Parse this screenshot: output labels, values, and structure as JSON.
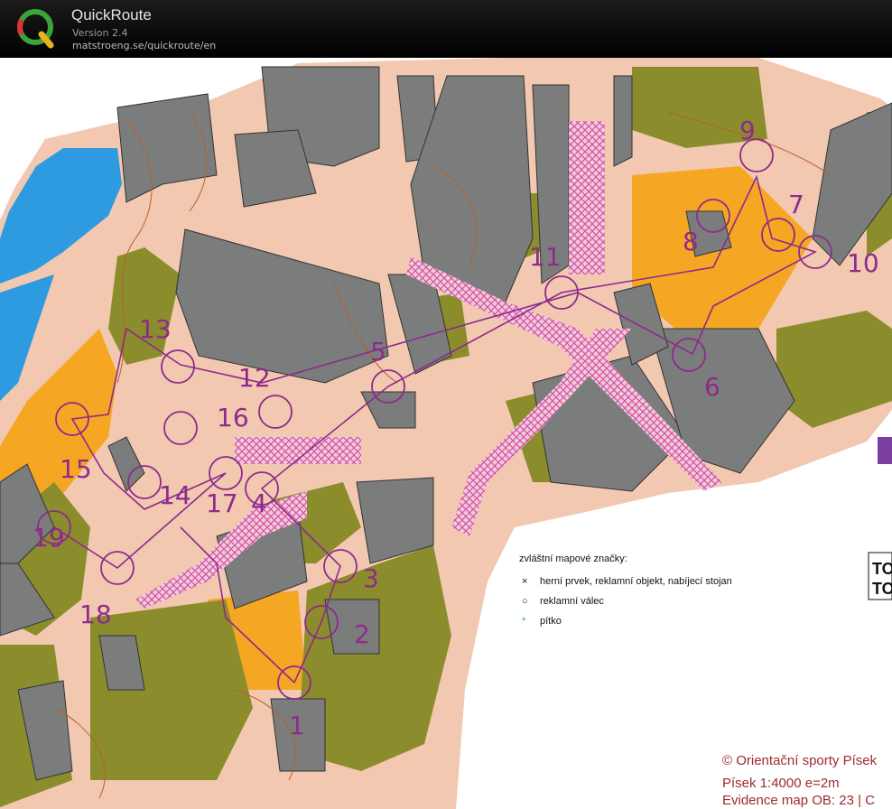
{
  "app": {
    "title": "QuickRoute",
    "version": "Version 2.4",
    "url": "matstroeng.se/quickroute/en"
  },
  "map": {
    "controls": [
      "1",
      "2",
      "3",
      "4",
      "5",
      "6",
      "7",
      "8",
      "9",
      "10",
      "11",
      "12",
      "13",
      "14",
      "15",
      "16",
      "17",
      "18",
      "19"
    ],
    "legend": {
      "title": "zvláštní mapové značky:",
      "items": [
        {
          "symbol": "×",
          "label": "herní prvek, reklamní objekt, nabíjecí stojan"
        },
        {
          "symbol": "○",
          "label": "reklamní válec"
        },
        {
          "symbol": "*",
          "label": "pítko"
        }
      ]
    },
    "credits": [
      "© Orientační sporty Písek",
      "Písek 1:4000  e=2m",
      "Evidence map OB: 23 | C"
    ],
    "colors": {
      "building": "#7a7d7c",
      "open_land": "#f6c28c",
      "green": "#8b8c2c",
      "water": "#2e9be0",
      "course": "#8e2a8c",
      "pedestrian_zone": "#e8a6d0",
      "paved": "#f2c6ae"
    }
  }
}
